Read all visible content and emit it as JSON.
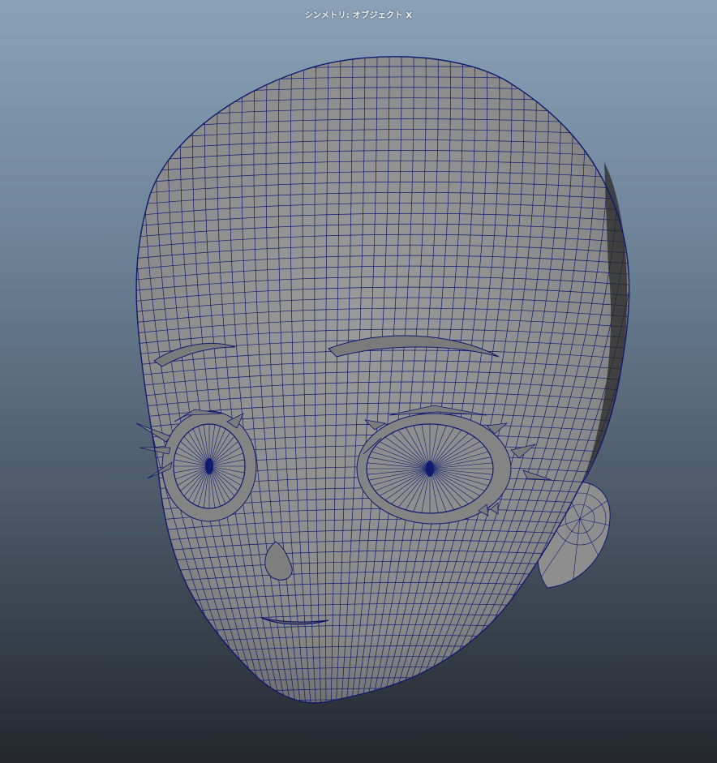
{
  "viewport": {
    "hud_label": "シンメトリ: オブジェクト X",
    "background_top_color": "#8aa1b8",
    "background_bottom_color": "#23272d"
  },
  "model": {
    "surface_color": "#8c8c8c",
    "wire_color": "#101a6e"
  }
}
